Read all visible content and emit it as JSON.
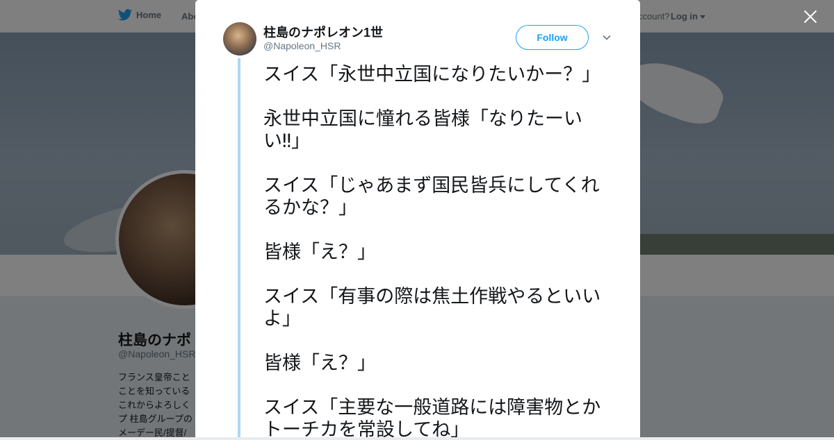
{
  "background_page": {
    "nav": {
      "home_label": "Home",
      "about_label": "Abo",
      "account_text": "ccount?",
      "login_label": "Log in"
    },
    "profile": {
      "name": "柱島のナポ",
      "handle": "@Napoleon_HSR",
      "bio_lines": [
        "フランス皇帝こと",
        "ことを知っている",
        "これからよろしく",
        "プ 柱島グループの",
        "メーデー民/提督/"
      ]
    }
  },
  "modal": {
    "author_name": "柱島のナポレオン1世",
    "author_handle": "@Napoleon_HSR",
    "follow_label": "Follow",
    "tweet_text": "スイス「永世中立国になりたいかー？」\n\n永世中立国に憧れる皆様「なりたーいい‼」\n\nスイス「じゃあまず国民皆兵にしてくれるかな？」\n\n皆様「え？」\n\nスイス「有事の際は焦土作戦やるといいよ」\n\n皆様「え？」\n\nスイス「主要な一般道路には障害物とかトーチカを常設してね」"
  },
  "colors": {
    "accent": "#1da1f2",
    "thread_line": "#aed6f5"
  }
}
